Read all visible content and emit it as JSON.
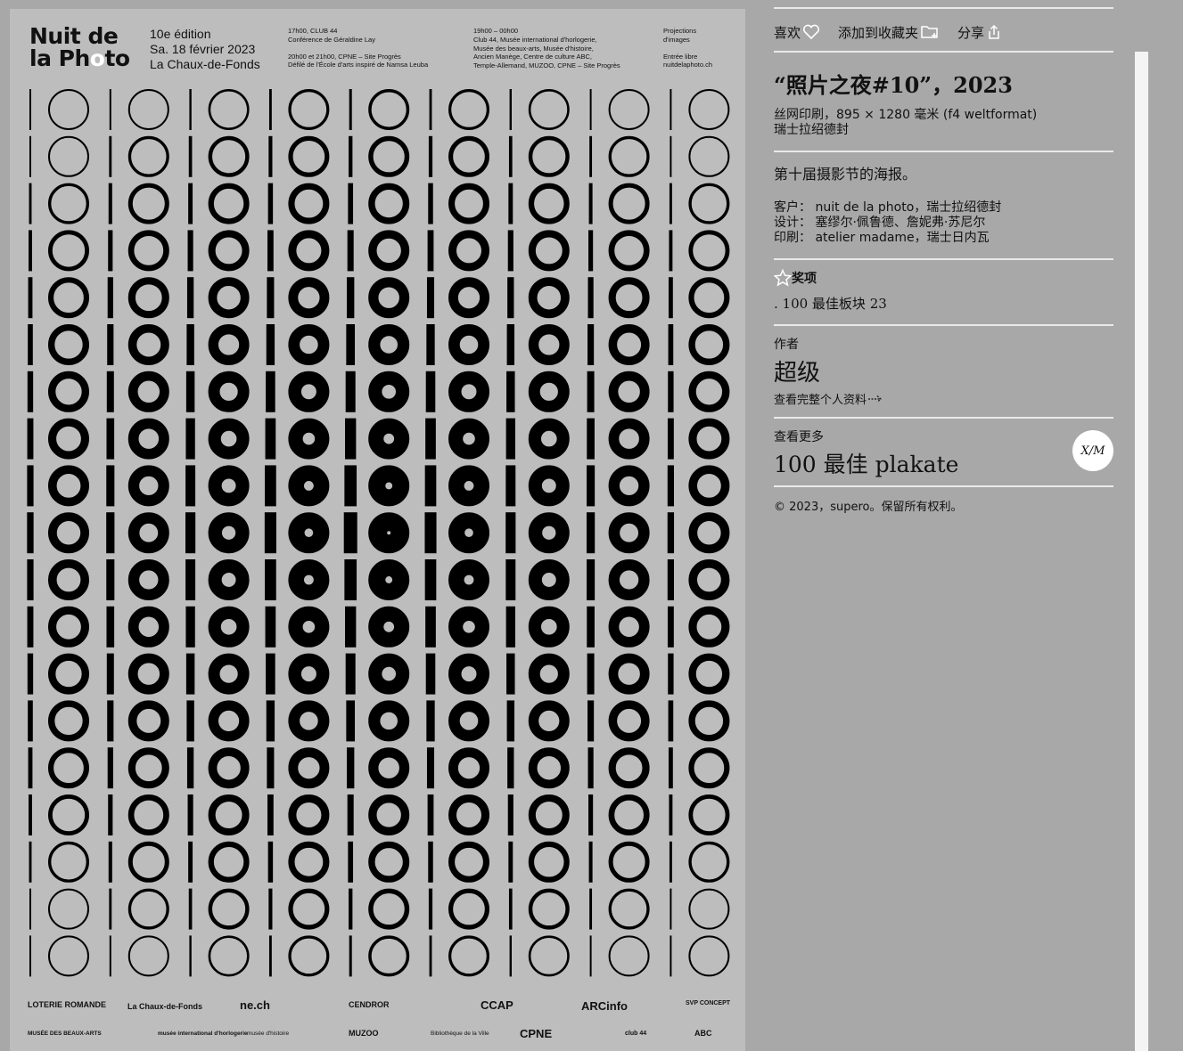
{
  "poster": {
    "title_line1": "Nuit de",
    "title_line2_a": "la Ph",
    "title_line2_b": "o",
    "title_line2_c": "to",
    "edition": [
      "10e édition",
      "Sa. 18 février 2023",
      "La Chaux-de-Fonds"
    ],
    "col1": [
      "17h00, CLUB 44",
      "Conférence de Géraldine Lay",
      "",
      "20h00 et 21h00, CPNE – Site Progrès",
      "Défilé de l'École d'arts inspiré de Namsa Leuba"
    ],
    "col2": [
      "19h00 – 00h00",
      "Club 44, Musée international d'horlogerie,",
      "Musée des beaux-arts, Musée d'histoire,",
      "Ancien Manège, Centre de culture ABC,",
      "Temple-Allemand, MUZOO, CPNE – Site Progrès"
    ],
    "col3": [
      "Projections",
      "d'images",
      "",
      "Entrée libre",
      "nuitdelaphoto.ch"
    ],
    "sponsors_row1": [
      "LOTERIE ROMANDE",
      "La Chaux-de-Fonds",
      "ne.ch",
      "CENDROR",
      "CCAP",
      "ARCinfo",
      "SVP CONCEPT"
    ],
    "sponsors_row2": [
      "MUSÉE DES BEAUX-ARTS",
      "musée international d'horlogerie",
      "musée d'histoire",
      "MUZOO",
      "Bibliothèque de la Ville",
      "CPNE",
      "club 44",
      "ABC"
    ]
  },
  "actions": {
    "like_label": "喜欢",
    "collect_label": "添加到收藏夹",
    "share_label": "分享"
  },
  "work": {
    "title": "“照片之夜#10”，2023",
    "spec": "丝网印刷，895 × 1280 毫米 (f4 weltformat)",
    "origin": "瑞士拉绍德封",
    "description": "第十届摄影节的海报。",
    "client": "客户： nuit de la photo，瑞士拉绍德封",
    "design": "设计： 塞缪尔·佩鲁德、詹妮弗·苏尼尔",
    "print": "印刷： atelier madame，瑞士日内瓦"
  },
  "award": {
    "heading": "奖项",
    "value": ". 100 最佳板块 23"
  },
  "author": {
    "label": "作者",
    "name": "超级",
    "profile_link": "查看完整个人资料"
  },
  "more": {
    "label": "查看更多",
    "name": "100 最佳 plakate",
    "badge_text": "X/M"
  },
  "footer": {
    "copyright": "© 2023，supero。保留所有权利。"
  },
  "colors": {
    "background": "#a8a8a8",
    "poster": "#bdbdbd",
    "divider": "#e9e9e9",
    "ink": "#111111"
  }
}
